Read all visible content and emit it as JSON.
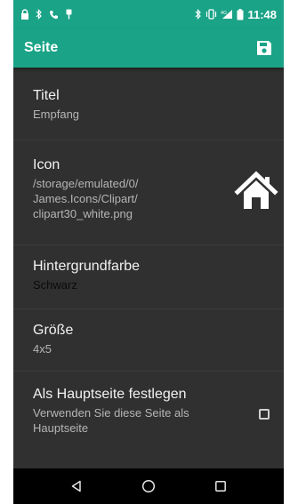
{
  "status_bar": {
    "time": "11:48",
    "left_icons": [
      "lock-icon",
      "bluetooth-icon",
      "phone-icon",
      "usb-icon"
    ],
    "right_icons": [
      "bluetooth-icon",
      "vibrate-icon",
      "signal-4g-icon",
      "battery-icon"
    ]
  },
  "app_bar": {
    "title": "Seite",
    "action_icon": "save-icon"
  },
  "preferences": {
    "titel": {
      "title": "Titel",
      "summary": "Empfang"
    },
    "icon": {
      "title": "Icon",
      "summary_lines": [
        "/storage/emulated/0/",
        "James.Icons/Clipart/",
        "clipart30_white.png"
      ],
      "preview_icon": "house-icon"
    },
    "background": {
      "title": "Hintergrundfarbe",
      "summary": "Schwarz"
    },
    "size": {
      "title": "Größe",
      "summary": "4x5"
    },
    "home_page": {
      "title": "Als Hauptseite festlegen",
      "summary_lines": [
        "Verwenden Sie diese Seite als",
        "Hauptseite"
      ],
      "checked": false
    }
  },
  "nav_bar": {
    "icons": [
      "back-icon",
      "home-circle-icon",
      "recents-icon"
    ]
  },
  "colors": {
    "accent": "#1aa387",
    "background": "#303030",
    "title_text": "#f2f2f2",
    "summary_text": "#b5b5b5"
  }
}
